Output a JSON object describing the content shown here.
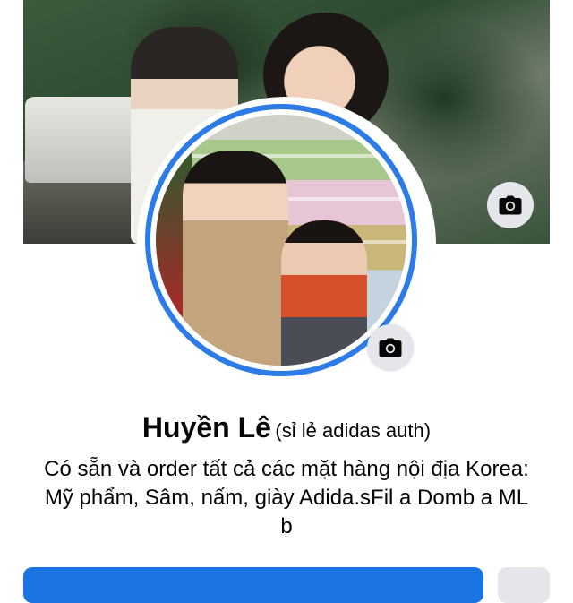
{
  "profile": {
    "name": "Huyền Lê",
    "alternate_name": "(sỉ lẻ adidas auth)",
    "bio_lines": [
      "Có sẵn và order tất cả các mặt hàng nội địa Korea:",
      "Mỹ phẩm, Sâm, nấm, giày Adida.sFil a Domb a ML",
      "b"
    ]
  },
  "icons": {
    "cover_camera": "camera-icon",
    "avatar_camera": "camera-icon"
  },
  "colors": {
    "ring": "#2d7be5",
    "primary_button": "#1b74e4",
    "secondary_button": "#e4e6eb",
    "camera_button_bg": "#e5e6eb"
  }
}
